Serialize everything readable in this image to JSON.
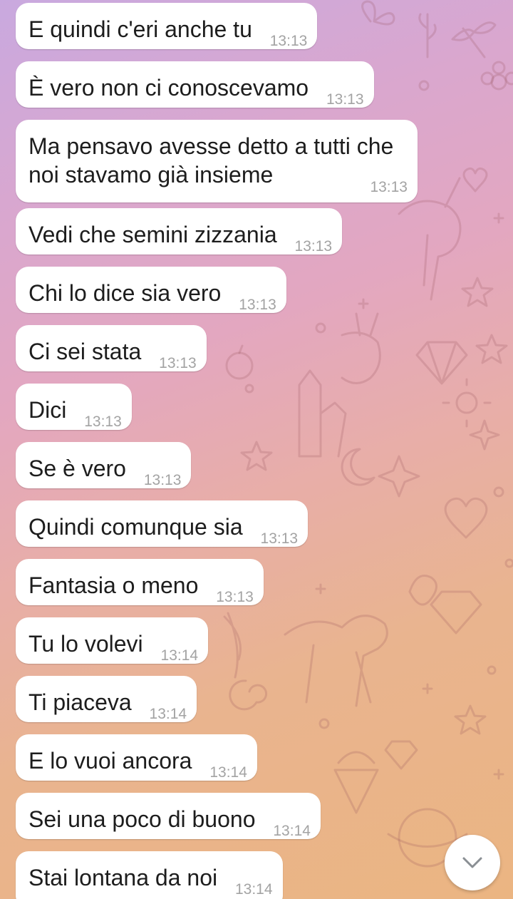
{
  "conversation": {
    "messages": [
      {
        "text": "E quindi c'eri anche tu",
        "time": "13:13"
      },
      {
        "text": "È vero non ci conoscevamo",
        "time": "13:13"
      },
      {
        "text": "Ma pensavo avesse detto a tutti che noi stavamo già insieme",
        "time": "13:13"
      },
      {
        "text": "Vedi che semini zizzania",
        "time": "13:13"
      },
      {
        "text": "Chi lo dice sia vero",
        "time": "13:13"
      },
      {
        "text": "Ci sei stata",
        "time": "13:13"
      },
      {
        "text": "Dici",
        "time": "13:13"
      },
      {
        "text": "Se è vero",
        "time": "13:13"
      },
      {
        "text": "Quindi comunque sia",
        "time": "13:13"
      },
      {
        "text": "Fantasia o meno",
        "time": "13:13"
      },
      {
        "text": "Tu lo volevi",
        "time": "13:14"
      },
      {
        "text": "Ti piaceva",
        "time": "13:14"
      },
      {
        "text": "E lo vuoi ancora",
        "time": "13:14"
      },
      {
        "text": "Sei una poco di buono",
        "time": "13:14"
      },
      {
        "text": "Stai lontana da noi",
        "time": "13:14"
      }
    ]
  },
  "controls": {
    "scroll_down_icon": "chevron-down-icon"
  },
  "theme": {
    "bubble_color": "#ffffff",
    "text_color": "#1d1d1d",
    "time_color": "#a3a3a3"
  }
}
